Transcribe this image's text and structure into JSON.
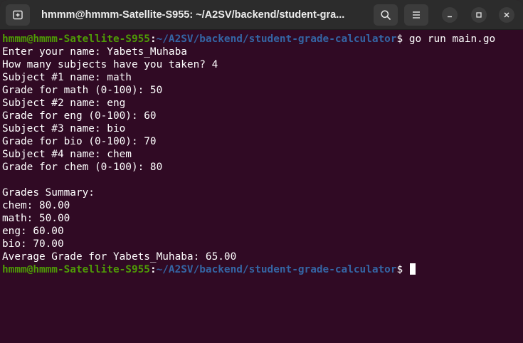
{
  "window": {
    "title": "hmmm@hmmm-Satellite-S955: ~/A2SV/backend/student-gra...",
    "colors": {
      "background": "#300a24",
      "prompt_user": "#4e9a06",
      "prompt_path": "#3465a4",
      "text": "#ffffff"
    }
  },
  "titlebar": {
    "new_tab_icon": "new-tab-icon",
    "search_icon": "search-icon",
    "menu_icon": "hamburger-menu-icon",
    "minimize_icon": "minimize-icon",
    "maximize_icon": "maximize-icon",
    "close_icon": "close-icon"
  },
  "prompt": {
    "user_host": "hmmm@hmmm-Satellite-S955",
    "separator": ":",
    "path": "~/A2SV/backend/student-grade-calculator",
    "symbol": "$"
  },
  "session": {
    "command": " go run main.go",
    "output": [
      "Enter your name: Yabets_Muhaba",
      "How many subjects have you taken? 4",
      "Subject #1 name: math",
      "Grade for math (0-100): 50",
      "Subject #2 name: eng",
      "Grade for eng (0-100): 60",
      "Subject #3 name: bio",
      "Grade for bio (0-100): 70",
      "Subject #4 name: chem",
      "Grade for chem (0-100): 80",
      "",
      "Grades Summary:",
      "chem: 80.00",
      "math: 50.00",
      "eng: 60.00",
      "bio: 70.00",
      "Average Grade for Yabets_Muhaba: 65.00"
    ]
  }
}
